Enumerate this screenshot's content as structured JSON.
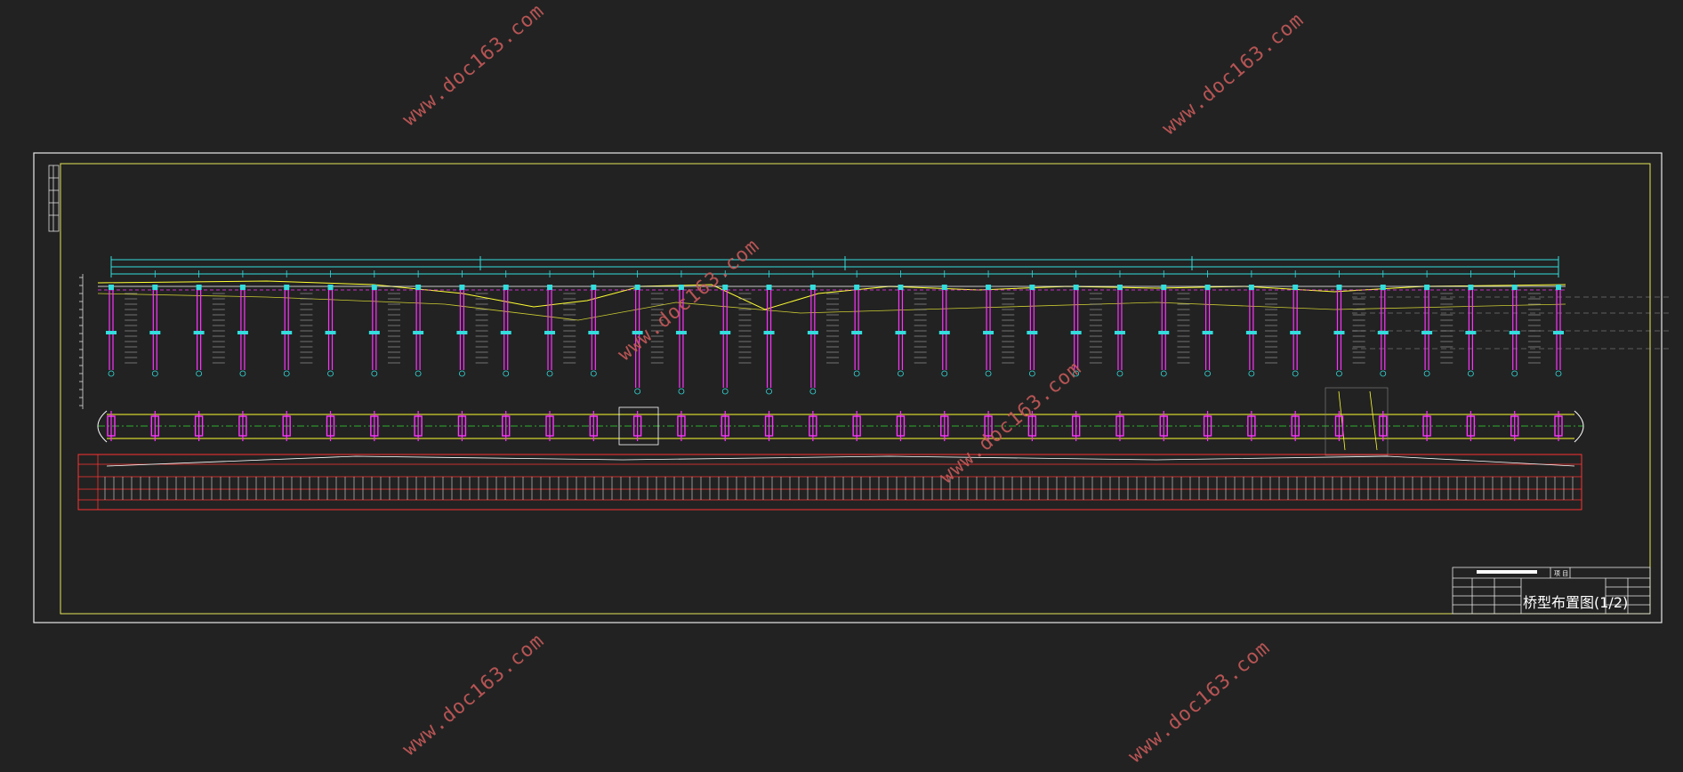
{
  "watermark": "www.doc163.com",
  "title_block": {
    "drawing_title": "桥型布置图(1/2)",
    "project_label": "项 目"
  },
  "colors": {
    "background": "#222222",
    "outer_frame": "#ffffff",
    "inner_frame": "#ffff66",
    "dimension_lines": "#33dddd",
    "piers": "#ff33ff",
    "ground_lines": "#ffff00",
    "table_border": "#ff3333",
    "watermark": "#c85a5a"
  },
  "piers": {
    "count": 34
  }
}
